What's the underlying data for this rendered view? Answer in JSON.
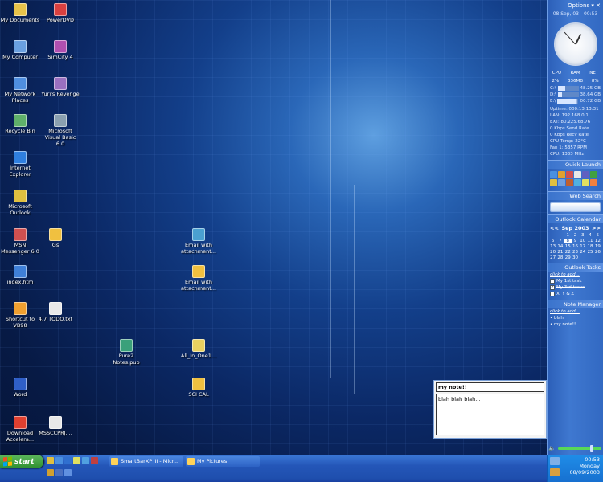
{
  "desktop": {
    "icons": [
      {
        "label": "My Documents",
        "color": "#e8c34a",
        "glyph": "folder-docs"
      },
      {
        "label": "PowerDVD",
        "color": "#d94040",
        "glyph": "dvd"
      },
      {
        "label": "My Computer",
        "color": "#6aa0e0",
        "glyph": "computer"
      },
      {
        "label": "SimCity 4",
        "color": "#b04fb0",
        "glyph": "simcity"
      },
      {
        "label": "My Network Places",
        "color": "#4f8fe0",
        "glyph": "network"
      },
      {
        "label": "Yuri's Revenge",
        "color": "#9a70c0",
        "glyph": "game"
      },
      {
        "label": "Recycle Bin",
        "color": "#5fb06a",
        "glyph": "recycle"
      },
      {
        "label": "Microsoft Visual Basic 6.0",
        "color": "#8aa0b0",
        "glyph": "vb"
      },
      {
        "label": "Internet Explorer",
        "color": "#2f7fe0",
        "glyph": "ie"
      },
      {
        "label": "Microsoft Outlook",
        "color": "#e0c040",
        "glyph": "outlook"
      },
      {
        "label": "MSN Messenger 6.0",
        "color": "#d05050",
        "glyph": "msn"
      },
      {
        "label": "Gs",
        "color": "#f0c040",
        "glyph": "folder"
      },
      {
        "label": "Email with attachment...",
        "color": "#4aa0d0",
        "glyph": "email"
      },
      {
        "label": "index.htm",
        "color": "#3f80d8",
        "glyph": "html"
      },
      {
        "label": "Email with attachment...",
        "color": "#f0c040",
        "glyph": "folder"
      },
      {
        "label": "Shortcut to VB98",
        "color": "#f0a030",
        "glyph": "shortcut"
      },
      {
        "label": "4.7 TODO.txt",
        "color": "#e8e8e8",
        "glyph": "text"
      },
      {
        "label": "Pure2 Notes.pub",
        "color": "#3aa07a",
        "glyph": "publisher"
      },
      {
        "label": "All_In_One1...",
        "color": "#e8d060",
        "glyph": "zip"
      },
      {
        "label": "SCI CAL",
        "color": "#f0c040",
        "glyph": "folder"
      },
      {
        "label": "Word",
        "color": "#2f5fc8",
        "glyph": "word"
      },
      {
        "label": "Download Accelera...",
        "color": "#e04030",
        "glyph": "download"
      },
      {
        "label": "MSSCCPRJ....",
        "color": "#e8e8e8",
        "glyph": "file"
      }
    ]
  },
  "sidebar": {
    "options_label": "Options",
    "date": "08 Sep, 03 - 00:53",
    "clock": {
      "hour": 12,
      "minute": 53,
      "second": 0
    },
    "perf": {
      "headers": [
        "CPU",
        "RAM",
        "NET"
      ],
      "values": [
        "2%",
        "336MB",
        "8%"
      ]
    },
    "drives": [
      {
        "label": "C:\\",
        "size": "48.25 GB",
        "usage": 0.35
      },
      {
        "label": "D:\\",
        "size": "38.64 GB",
        "usage": 0.2
      },
      {
        "label": "E:\\",
        "size": "00.72 GB",
        "usage": 0.95
      }
    ],
    "stats": [
      "Uptime: 000:13:13:31",
      "LAN: 192.168.0.1",
      "EXT: 80.225.68.76",
      "0 Kbps Send Rate",
      "0 Kbps Recv Rate",
      "CPU Temp: 22°C",
      "Fan 1: 5357 RPM",
      "CPU: 1333 MHz"
    ],
    "quick_launch_title": "Quick Launch",
    "web_search_title": "Web Search",
    "calendar": {
      "title": "Outlook Calendar",
      "month": "Sep 2003",
      "prev": "<<",
      "next": ">>",
      "days": [
        "",
        "",
        "1",
        "2",
        "3",
        "4",
        "5",
        "6",
        "7",
        "8",
        "9",
        "10",
        "11",
        "12",
        "13",
        "14",
        "15",
        "16",
        "17",
        "18",
        "19",
        "20",
        "21",
        "22",
        "23",
        "24",
        "25",
        "26",
        "27",
        "28",
        "29",
        "30"
      ],
      "selected": "8"
    },
    "tasks": {
      "title": "Outlook Tasks",
      "add": "click to add...",
      "items": [
        {
          "label": "My 1st task",
          "done": false
        },
        {
          "label": "My 3rd tasks",
          "done": true
        },
        {
          "label": "X, Y & Z",
          "done": false
        }
      ]
    },
    "notes": {
      "title": "Note Manager",
      "add": "click to add...",
      "items": [
        "blah",
        "my note!!"
      ]
    }
  },
  "note_window": {
    "title": "my note!!",
    "body": "blah blah blah..."
  },
  "taskbar": {
    "start_label": "start",
    "windows": [
      "SmartBarXP_II - Micr...",
      "My Pictures"
    ],
    "clock": {
      "time": "00:53",
      "day": "Monday",
      "date": "08/09/2003"
    }
  }
}
